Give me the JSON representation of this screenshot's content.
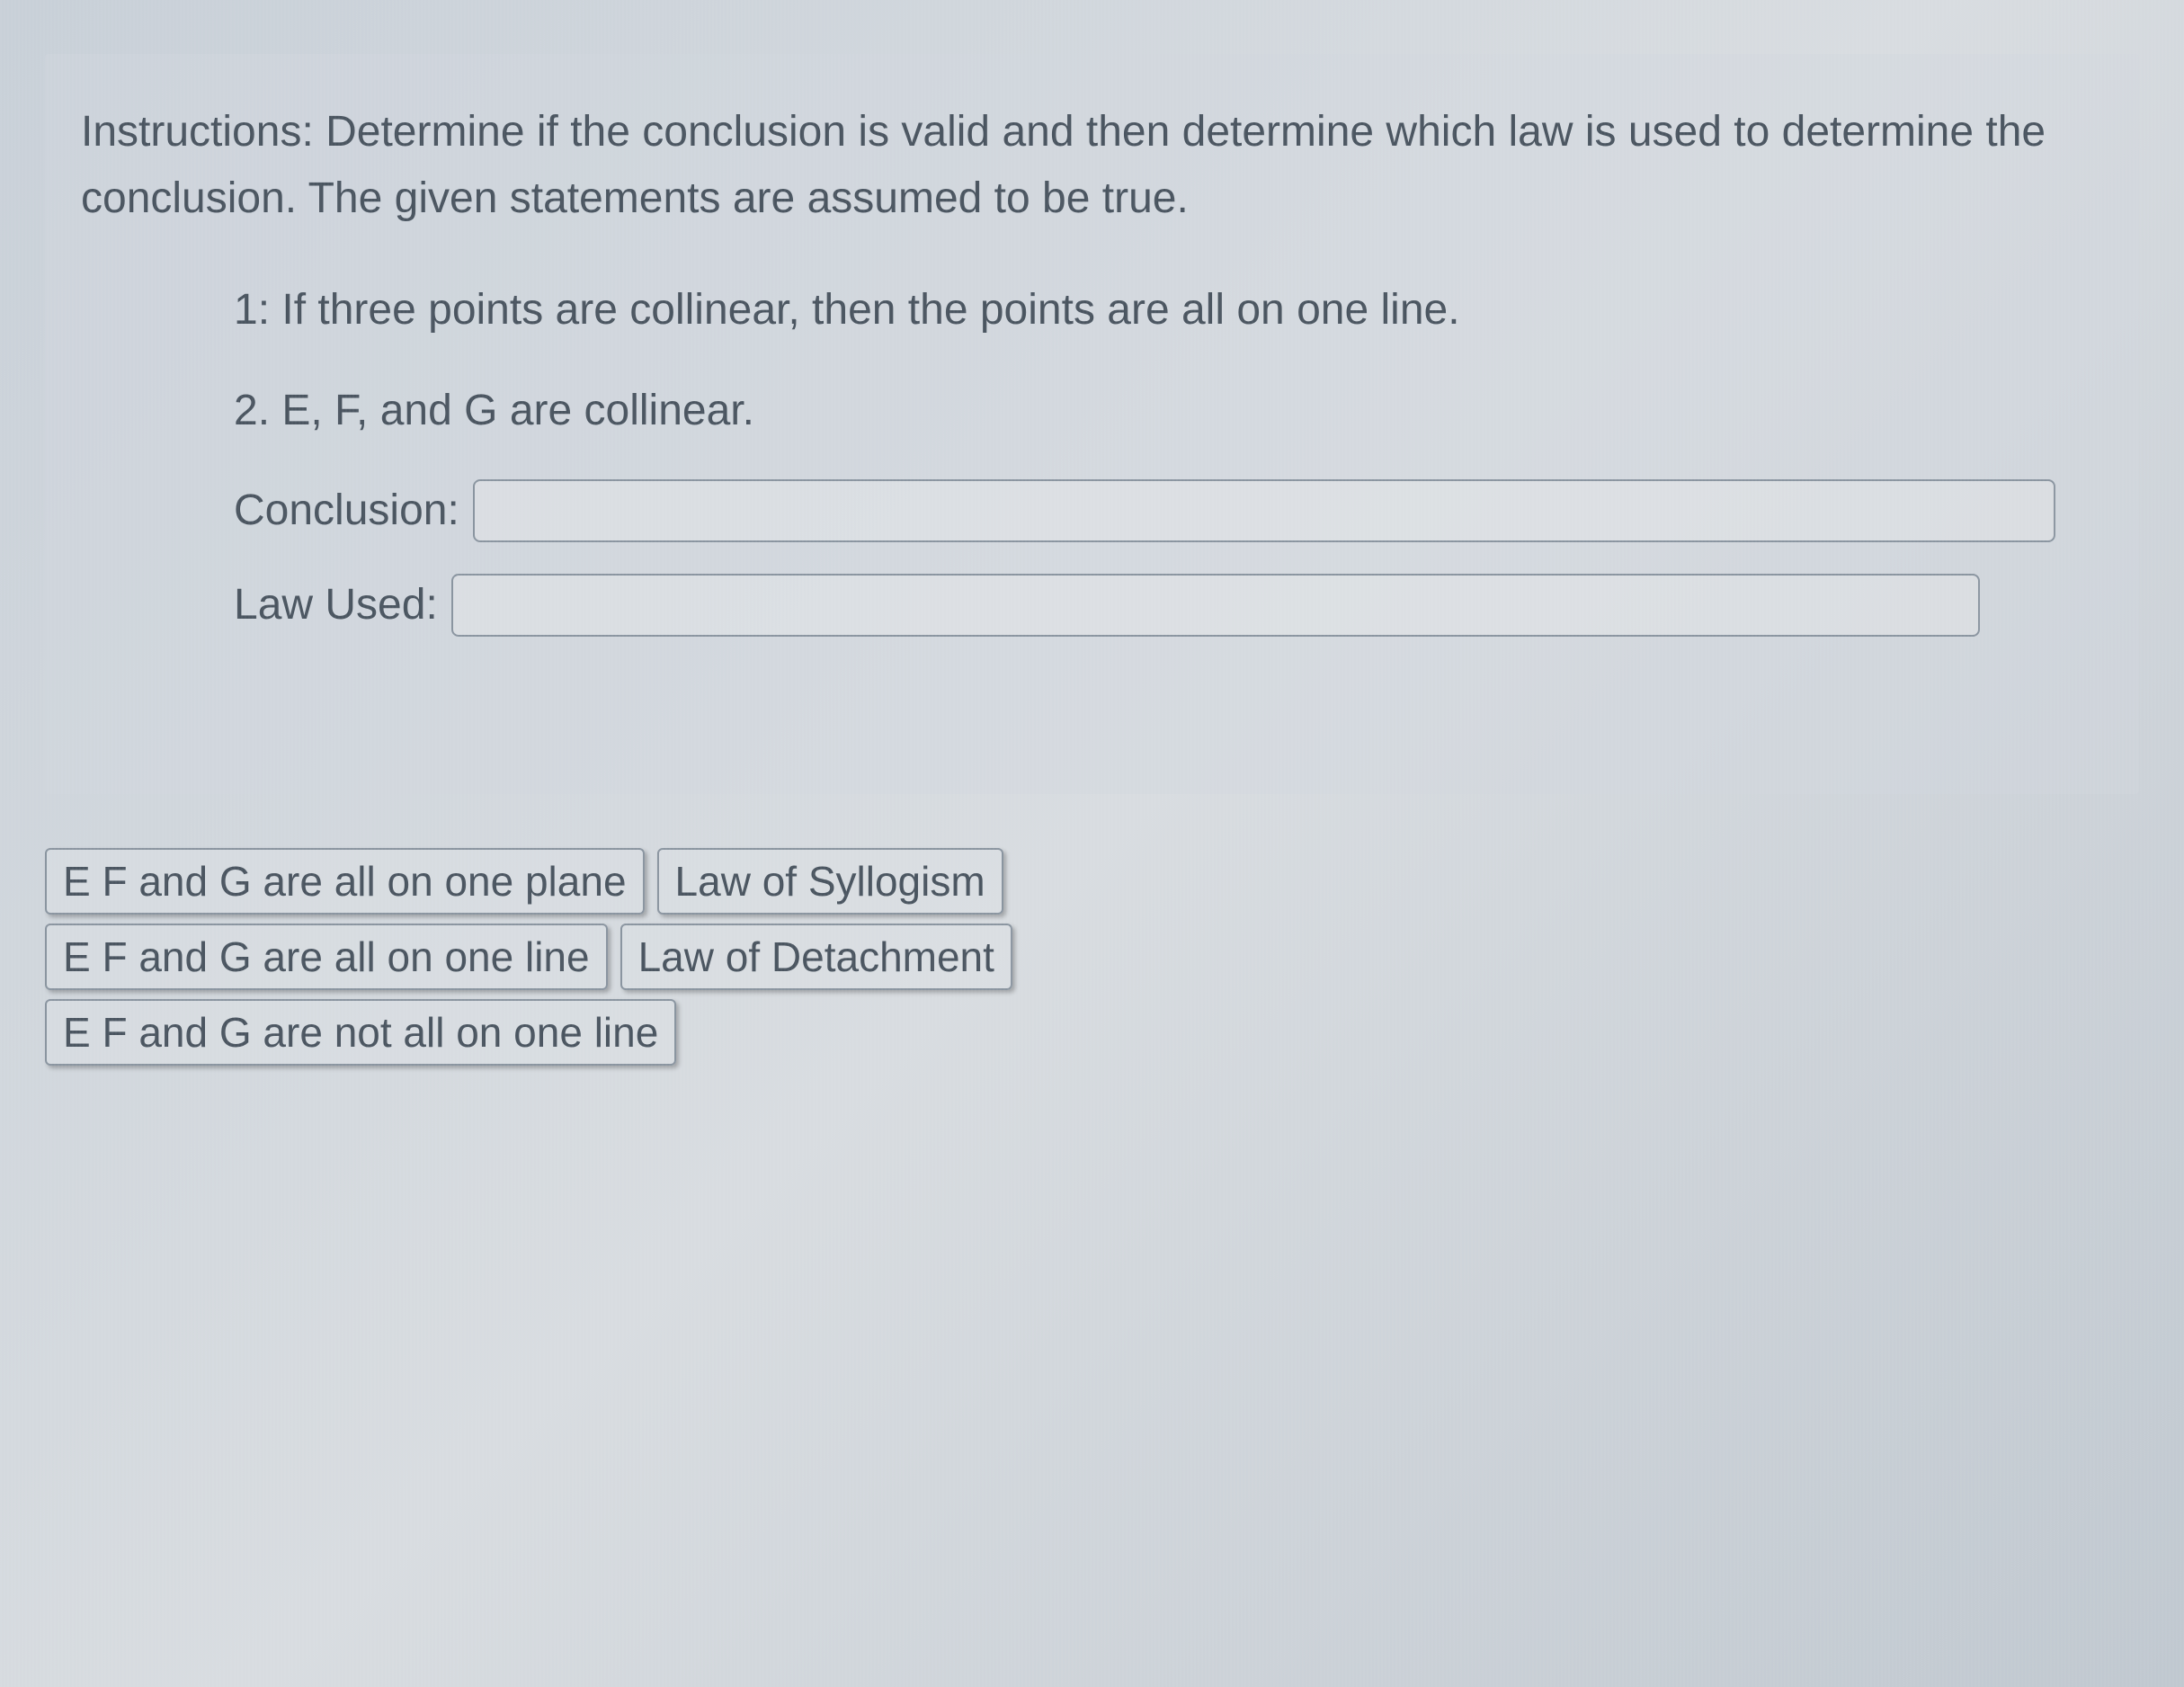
{
  "instructions": "Instructions: Determine if the conclusion is valid and then determine which law is used to determine the conclusion. The given statements are assumed to be true.",
  "statements": {
    "s1": "1: If three points are collinear, then the points are all on one line.",
    "s2": "2. E, F, and G are collinear."
  },
  "fields": {
    "conclusion_label": "Conclusion:",
    "conclusion_value": "",
    "law_label": "Law Used:",
    "law_value": ""
  },
  "options": {
    "row1": {
      "opt1": "E F and G are all on one plane",
      "opt2": "Law of Syllogism"
    },
    "row2": {
      "opt1": "E F and G are all on one line",
      "opt2": "Law of Detachment"
    },
    "row3": {
      "opt1": "E F and G are not all on one line"
    }
  }
}
